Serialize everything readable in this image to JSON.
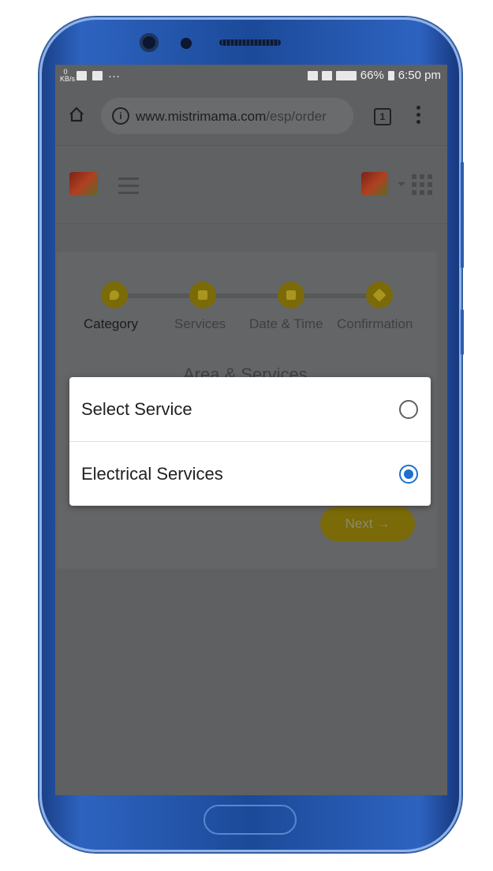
{
  "status_bar": {
    "kbs": "0 KB/s",
    "dots": "···",
    "battery": "66%",
    "time": "6:50 pm"
  },
  "browser": {
    "url_domain": "www.mistrimama.com",
    "url_path": "/esp/order",
    "tab_count": "1",
    "info_glyph": "i"
  },
  "steps": [
    {
      "label": "Category",
      "icon": "map-pin-icon",
      "active": true
    },
    {
      "label": "Services",
      "icon": "list-icon",
      "active": false
    },
    {
      "label": "Date & Time",
      "icon": "calendar-icon",
      "active": false
    },
    {
      "label": "Confirmation",
      "icon": "check-icon",
      "active": false
    }
  ],
  "section_title": "Area & Services",
  "next_button": "Next →",
  "dialog": {
    "options": [
      {
        "label": "Select Service",
        "selected": false
      },
      {
        "label": "Electrical Services",
        "selected": true
      }
    ]
  },
  "colors": {
    "accent_radio": "#1e6fd0",
    "brand_yellow": "#f0c800",
    "overlay": "#5f6062"
  }
}
